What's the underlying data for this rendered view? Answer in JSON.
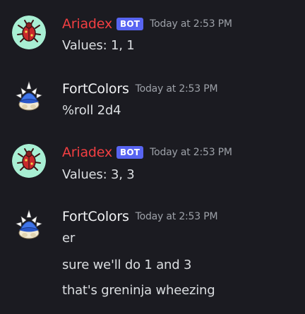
{
  "messages": [
    {
      "username": "Ariadex",
      "bot_tag": "BOT",
      "timestamp": "Today at 2:53 PM",
      "avatar_icon": "beetle-avatar-icon",
      "lines": [
        "Values: 1, 1"
      ]
    },
    {
      "username": "FortColors",
      "timestamp": "Today at 2:53 PM",
      "avatar_icon": "blue-spiny-shell-avatar-icon",
      "lines": [
        "%roll 2d4"
      ]
    },
    {
      "username": "Ariadex",
      "bot_tag": "BOT",
      "timestamp": "Today at 2:53 PM",
      "avatar_icon": "beetle-avatar-icon",
      "lines": [
        "Values: 3, 3"
      ]
    },
    {
      "username": "FortColors",
      "timestamp": "Today at 2:53 PM",
      "avatar_icon": "blue-spiny-shell-avatar-icon",
      "lines": [
        "er",
        "sure we'll do 1 and 3",
        "that's greninja wheezing"
      ]
    }
  ],
  "colors": {
    "background": "#1b1b21",
    "bot_name": "#f23f42",
    "user_name": "#f2f3f5",
    "bot_tag": "#5865f2",
    "timestamp": "#9da1a8",
    "message_text": "#dbdee1"
  }
}
